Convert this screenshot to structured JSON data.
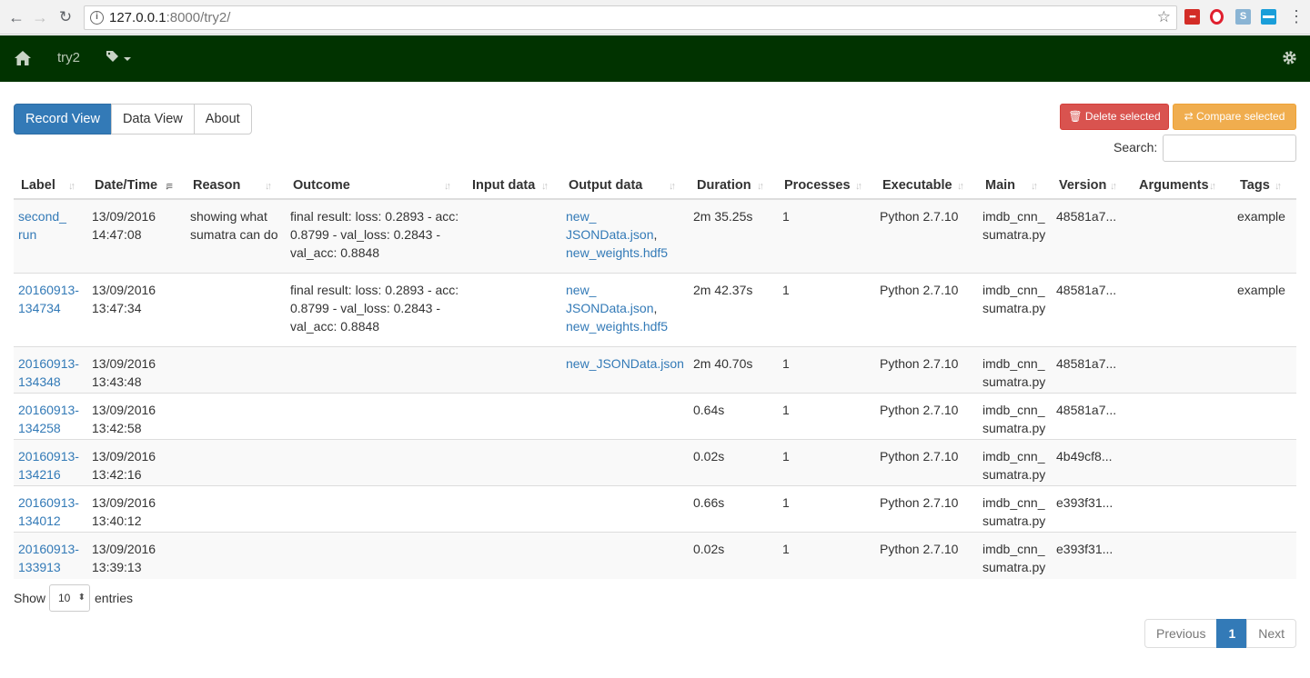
{
  "browser": {
    "url_host": "127.0.0.1",
    "url_rest": ":8000/try2/",
    "accent": "#013300"
  },
  "navbar": {
    "brand": "try2"
  },
  "tabs": [
    "Record View",
    "Data View",
    "About"
  ],
  "actions": {
    "delete_label": "Delete selected",
    "compare_label": "Compare selected"
  },
  "search": {
    "label": "Search:",
    "placeholder": ""
  },
  "table": {
    "headers": [
      "Label",
      "Date/Time",
      "Reason",
      "Outcome",
      "Input data",
      "Output data",
      "Duration",
      "Processes",
      "Executable",
      "Main",
      "Version",
      "Arguments",
      "Tags"
    ],
    "rows": [
      {
        "label": [
          "second_",
          "run"
        ],
        "datetime": [
          "13/09/2016",
          "14:47:08"
        ],
        "reason": [
          "showing what",
          "sumatra can do"
        ],
        "outcome": [
          "final result: loss: 0.2893 - acc:",
          "0.8799 - val_loss: 0.2843 -",
          "val_acc: 0.8848"
        ],
        "output": [
          "new_",
          "JSONData.json",
          ",",
          "new_weights.hdf5"
        ],
        "duration": "2m 35.25s",
        "processes": "1",
        "executable": "Python 2.7.10",
        "main": [
          "imdb_cnn_",
          "sumatra.py"
        ],
        "version": "48581a7...",
        "tags": "example"
      },
      {
        "label": [
          "20160913-",
          "134734"
        ],
        "datetime": [
          "13/09/2016",
          "13:47:34"
        ],
        "reason": [
          "",
          ""
        ],
        "outcome": [
          "final result: loss: 0.2893 - acc:",
          "0.8799 - val_loss: 0.2843 -",
          "val_acc: 0.8848"
        ],
        "output": [
          "new_",
          "JSONData.json",
          ",",
          "new_weights.hdf5"
        ],
        "duration": "2m 42.37s",
        "processes": "1",
        "executable": "Python 2.7.10",
        "main": [
          "imdb_cnn_",
          "sumatra.py"
        ],
        "version": "48581a7...",
        "tags": "example"
      },
      {
        "label": [
          "20160913-",
          "134348"
        ],
        "datetime": [
          "13/09/2016",
          "13:43:48"
        ],
        "output_single": "new_JSONData.json",
        "duration": "2m 40.70s",
        "processes": "1",
        "executable": "Python 2.7.10",
        "main": [
          "imdb_cnn_",
          "sumatra.py"
        ],
        "version": "48581a7..."
      },
      {
        "label": [
          "20160913-",
          "134258"
        ],
        "datetime": [
          "13/09/2016",
          "13:42:58"
        ],
        "duration": "0.64s",
        "processes": "1",
        "executable": "Python 2.7.10",
        "main": [
          "imdb_cnn_",
          "sumatra.py"
        ],
        "version": "48581a7..."
      },
      {
        "label": [
          "20160913-",
          "134216"
        ],
        "datetime": [
          "13/09/2016",
          "13:42:16"
        ],
        "duration": "0.02s",
        "processes": "1",
        "executable": "Python 2.7.10",
        "main": [
          "imdb_cnn_",
          "sumatra.py"
        ],
        "version": "4b49cf8..."
      },
      {
        "label": [
          "20160913-",
          "134012"
        ],
        "datetime": [
          "13/09/2016",
          "13:40:12"
        ],
        "duration": "0.66s",
        "processes": "1",
        "executable": "Python 2.7.10",
        "main": [
          "imdb_cnn_",
          "sumatra.py"
        ],
        "version": "e393f31..."
      },
      {
        "label": [
          "20160913-",
          "133913"
        ],
        "datetime": [
          "13/09/2016",
          "13:39:13"
        ],
        "duration": "0.02s",
        "processes": "1",
        "executable": "Python 2.7.10",
        "main": [
          "imdb_cnn_",
          "sumatra.py"
        ],
        "version": "e393f31..."
      }
    ]
  },
  "length": {
    "show_label": "Show",
    "value": "10",
    "entries_label": "entries"
  },
  "pagination": {
    "previous": "Previous",
    "current": "1",
    "next": "Next"
  }
}
